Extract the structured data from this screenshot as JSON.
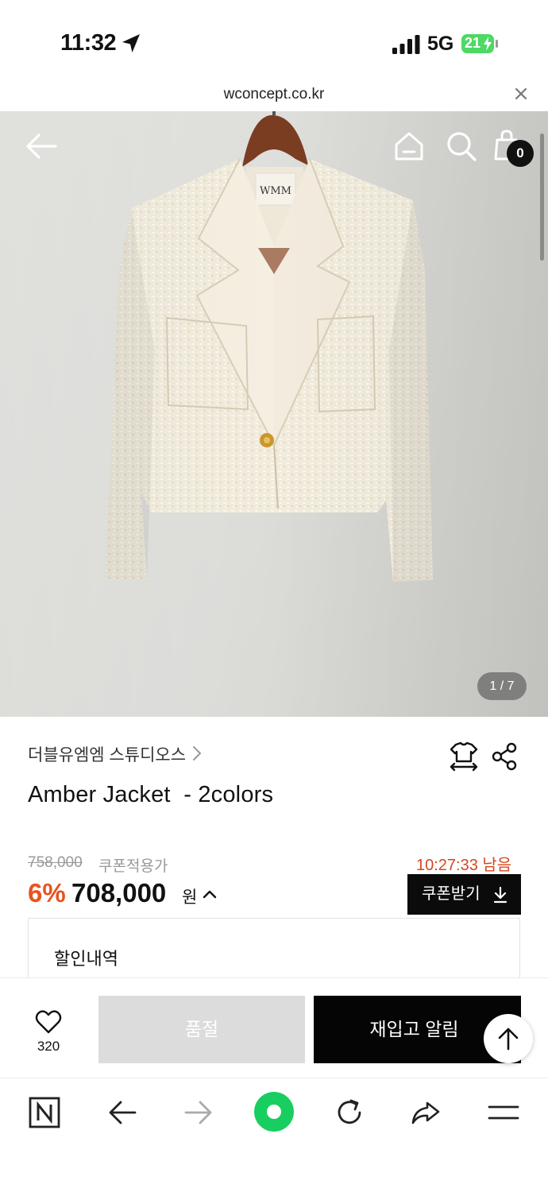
{
  "status_bar": {
    "time": "11:32",
    "network": "5G",
    "battery": "21"
  },
  "url_bar": {
    "url": "wconcept.co.kr"
  },
  "hero": {
    "garment_label": "WMM",
    "cart_count": "0",
    "image_counter": "1 / 7",
    "icons": [
      "back-arrow-icon",
      "home-icon",
      "search-icon",
      "shopping-bag-icon"
    ]
  },
  "product": {
    "brand": "더블유엠엠 스튜디오스",
    "title": "Amber Jacket  - 2colors",
    "original_price": "758,000",
    "coupon_label": "쿠폰적용가",
    "timer": "10:27:33 남음",
    "discount_rate": "6%",
    "final_price": "708,000",
    "currency": "원",
    "coupon_button": "쿠폰받기",
    "discount_section_title": "할인내역"
  },
  "purchase_bar": {
    "wish_count": "320",
    "soldout_label": "품절",
    "restock_label": "재입고 알림"
  },
  "browser_bar": {
    "icons": [
      "naver-icon",
      "back-icon",
      "forward-icon",
      "green-dot-icon",
      "reload-icon",
      "share-icon",
      "menu-icon"
    ]
  },
  "colors": {
    "accent_orange": "#e8531f",
    "timer_orange": "#d4481f",
    "button_black": "#050505",
    "soldout_gray": "#dcdcdc",
    "naver_green": "#19ce60"
  }
}
